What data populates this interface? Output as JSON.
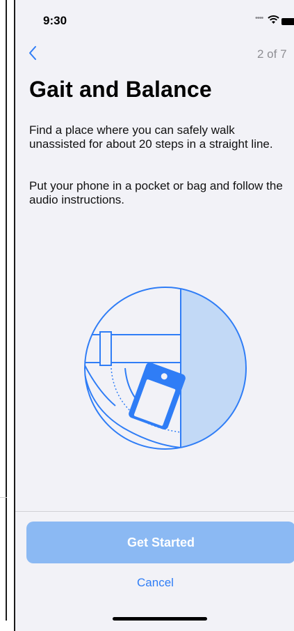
{
  "status_bar": {
    "time": "9:30",
    "signal_icon": "signal-dots-icon",
    "wifi_icon": "wifi-icon",
    "battery_icon": "battery-icon"
  },
  "nav": {
    "back_icon": "chevron-left-icon",
    "step_counter": "2 of 7"
  },
  "content": {
    "title": "Gait and Balance",
    "paragraph1": "Find a place where you can safely walk unassisted for about 20 steps in a straight line.",
    "paragraph2": "Put your phone in a pocket or bag and follow the audio instructions.",
    "illustration_icon": "phone-in-pocket-illustration"
  },
  "footer": {
    "primary_label": "Get Started",
    "cancel_label": "Cancel"
  },
  "colors": {
    "accent": "#2f7df6",
    "primary_button": "#8bb9f3",
    "illustration_fill": "#c2d9f6",
    "background": "#f2f2f7"
  }
}
